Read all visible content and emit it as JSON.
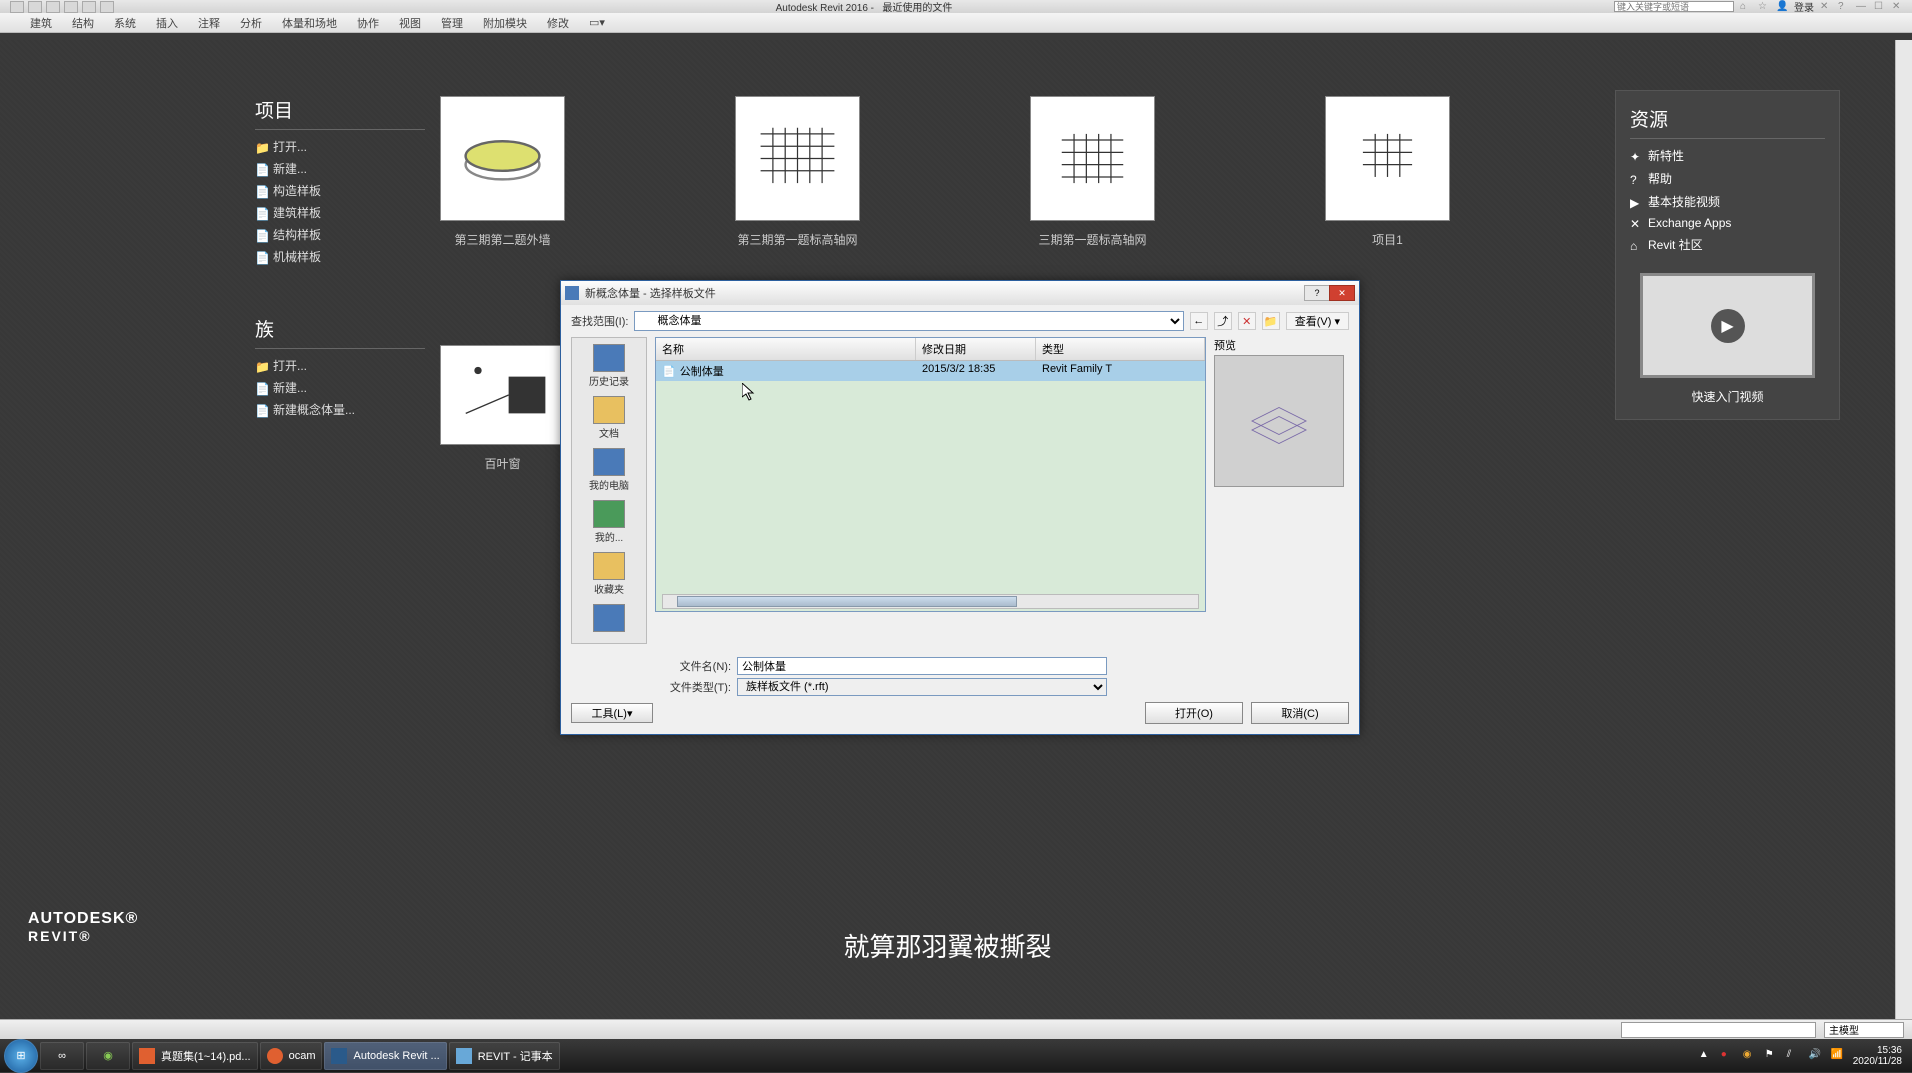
{
  "app": {
    "title": "Autodesk Revit 2016 -",
    "subtitle": "最近使用的文件",
    "search_placeholder": "键入关键字或短语",
    "login": "登录"
  },
  "ribbon": [
    "建筑",
    "结构",
    "系统",
    "插入",
    "注释",
    "分析",
    "体量和场地",
    "协作",
    "视图",
    "管理",
    "附加模块",
    "修改"
  ],
  "sections": {
    "projects": {
      "title": "项目",
      "items": [
        "打开...",
        "新建...",
        "构造样板",
        "建筑样板",
        "结构样板",
        "机械样板"
      ]
    },
    "families": {
      "title": "族",
      "items": [
        "打开...",
        "新建...",
        "新建概念体量..."
      ]
    }
  },
  "thumbs": [
    {
      "label": "第三期第二题外墙"
    },
    {
      "label": "第三期第一题标高轴网"
    },
    {
      "label": "三期第一题标高轴网"
    },
    {
      "label": "项目1"
    }
  ],
  "fam_thumb": {
    "label": "百叶窗"
  },
  "resources": {
    "title": "资源",
    "items": [
      "新特性",
      "帮助",
      "基本技能视频",
      "Exchange Apps",
      "Revit 社区"
    ],
    "video": "快速入门视频"
  },
  "logo": {
    "l1": "AUTODESK®",
    "l2": "REVIT®"
  },
  "caption": "就算那羽翼被撕裂",
  "dialog": {
    "title": "新概念体量 - 选择样板文件",
    "lookin_label": "查找范围(I):",
    "lookin_value": "概念体量",
    "view_btn": "查看(V)",
    "cols": {
      "name": "名称",
      "date": "修改日期",
      "type": "类型"
    },
    "row": {
      "name": "公制体量",
      "date": "2015/3/2 18:35",
      "type": "Revit Family T"
    },
    "preview": "预览",
    "filename_label": "文件名(N):",
    "filename_value": "公制体量",
    "filetype_label": "文件类型(T):",
    "filetype_value": "族样板文件 (*.rft)",
    "tools": "工具(L)",
    "open": "打开(O)",
    "cancel": "取消(C)",
    "places": [
      "历史记录",
      "文档",
      "我的电脑",
      "我的...",
      "收藏夹"
    ]
  },
  "status": {
    "main_model": "主模型"
  },
  "taskbar": {
    "items": [
      {
        "label": "真题集(1~14).pd..."
      },
      {
        "label": "ocam"
      },
      {
        "label": "Autodesk Revit ...",
        "active": true
      },
      {
        "label": "REVIT - 记事本"
      }
    ],
    "time": "15:36",
    "date": "2020/11/28"
  }
}
